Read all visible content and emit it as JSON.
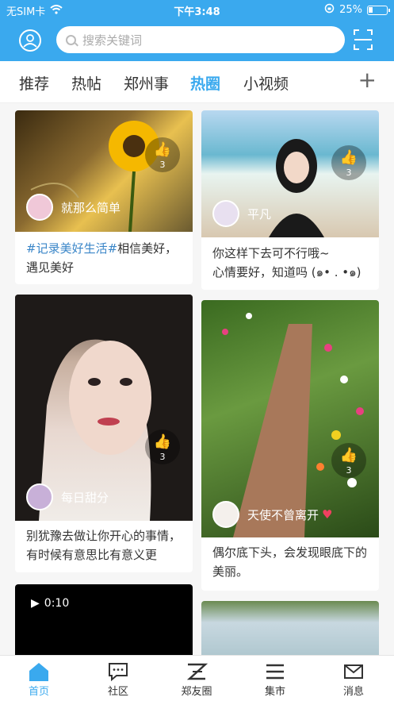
{
  "status": {
    "carrier": "无SIM卡",
    "time": "下午3:48",
    "battery": "25%"
  },
  "search": {
    "placeholder": "搜索关键词"
  },
  "tabs": [
    "推荐",
    "热帖",
    "郑州事",
    "热圈",
    "小视频"
  ],
  "active_tab": "热圈",
  "cards": [
    {
      "user": "就那么简单",
      "likes": "3",
      "tag": "#记录美好生活#",
      "text": "相信美好，遇见美好"
    },
    {
      "user": "平凡",
      "likes": "3",
      "text": "你这样下去可不行哦~\n心情要好，知道吗 (๑• . •๑)"
    },
    {
      "user": "每日甜分",
      "likes": "3",
      "text": "别犹豫去做让你开心的事情，有时候有意思比有意义更"
    },
    {
      "user": "天使不曾离开",
      "likes": "3",
      "text": "偶尔底下头，会发现眼底下的美丽。"
    },
    {
      "video_time": "0:10"
    }
  ],
  "tabbar": [
    "首页",
    "社区",
    "郑友圈",
    "集市",
    "消息"
  ],
  "colors": {
    "accent": "#3aa9ee",
    "hashtag": "#3a86c8"
  }
}
